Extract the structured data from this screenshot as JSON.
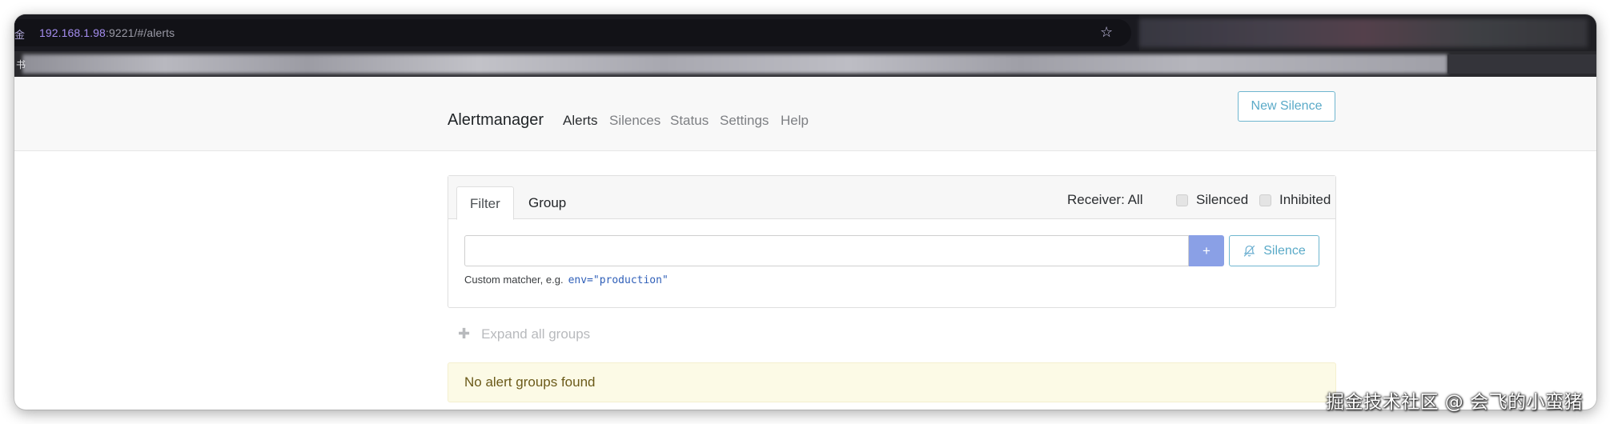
{
  "browser": {
    "lock_glyph": "金",
    "url_host": "192.168.1.98",
    "url_rest": ":9221/#/alerts",
    "bookmark_glyph": "书"
  },
  "navbar": {
    "brand": "Alertmanager",
    "items": [
      {
        "label": "Alerts",
        "active": true
      },
      {
        "label": "Silences",
        "active": false
      },
      {
        "label": "Status",
        "active": false
      },
      {
        "label": "Settings",
        "active": false
      },
      {
        "label": "Help",
        "active": false
      }
    ],
    "new_silence_label": "New Silence"
  },
  "filter_card": {
    "tabs": [
      {
        "label": "Filter",
        "active": true
      },
      {
        "label": "Group",
        "active": false
      }
    ],
    "receiver_label": "Receiver: All",
    "silenced_label": "Silenced",
    "inhibited_label": "Inhibited",
    "filter_input_value": "",
    "plus_label": "+",
    "silence_button_label": "Silence",
    "hint_text": "Custom matcher, e.g.",
    "hint_example": "env=\"production\""
  },
  "expand_all_label": "Expand all groups",
  "empty_message": "No alert groups found",
  "watermark": "掘金技术社区 @ 会飞的小蛮猪",
  "colors": {
    "accent": "#5aaac8",
    "plus_button": "#8aa0e6",
    "alert_bg": "#fcfae6",
    "navbar_bg": "#f8f8f8"
  }
}
